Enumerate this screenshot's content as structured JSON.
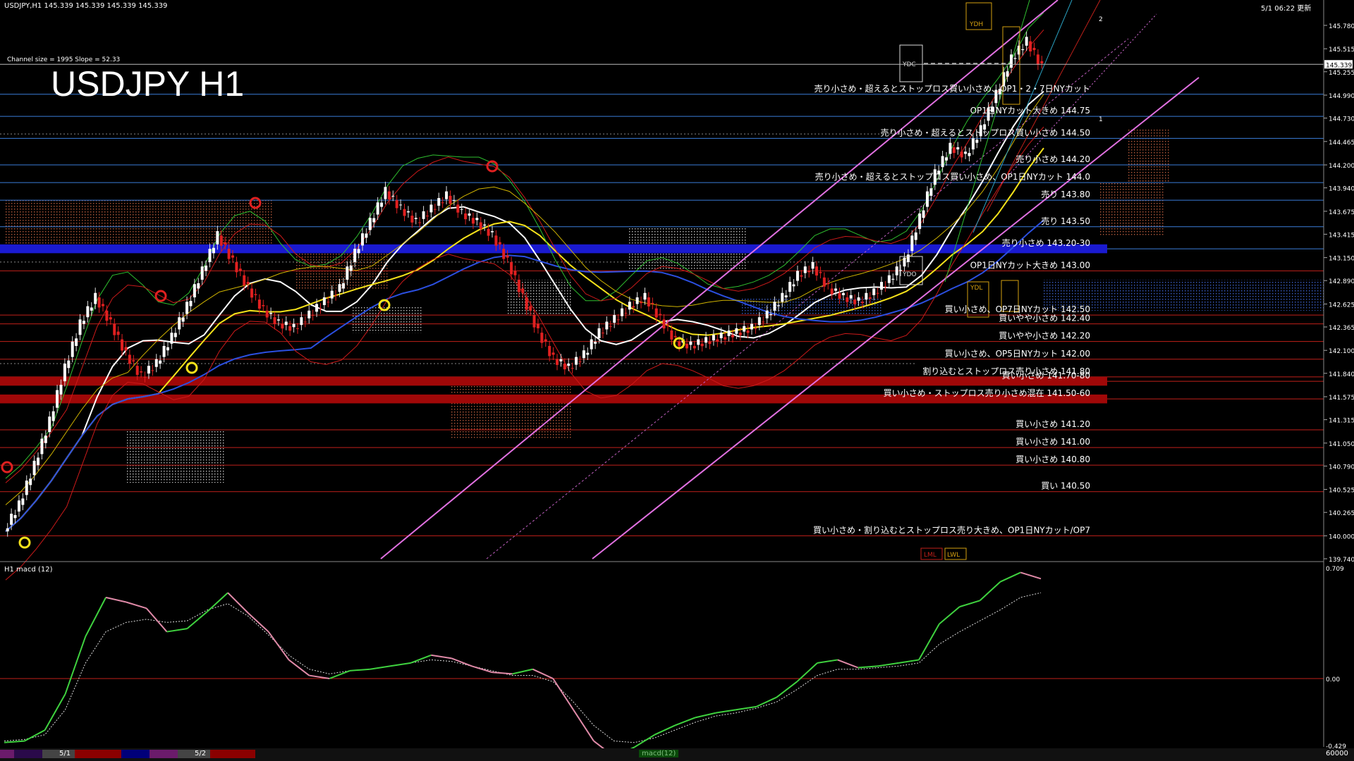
{
  "header": {
    "symbol_info": "USDJPY,H1  145.339 145.339 145.339 145.339",
    "timestamp": "5/1 06:22 更新",
    "channel_info": "Channel size = 1995 Slope = 52.33",
    "big_title": "USDJPY H1"
  },
  "chart_data": [
    {
      "type": "line",
      "title": "USDJPY H1",
      "ylim": [
        139.74,
        145.78
      ],
      "y_ticks": [
        "145.780",
        "145.515",
        "145.255",
        "144.990",
        "144.730",
        "144.465",
        "144.200",
        "143.940",
        "143.675",
        "143.415",
        "143.150",
        "142.890",
        "142.625",
        "142.365",
        "142.100",
        "141.840",
        "141.575",
        "141.315",
        "141.050",
        "140.790",
        "140.525",
        "140.265",
        "140.000",
        "139.740"
      ],
      "current_price": "145.339",
      "grid": false,
      "x_labels": [
        "5/1",
        "5/2"
      ],
      "price_path": [
        140.05,
        140.35,
        140.8,
        141.3,
        141.9,
        142.4,
        142.7,
        142.4,
        142.05,
        141.8,
        141.95,
        142.25,
        142.6,
        143.0,
        143.4,
        143.1,
        142.8,
        142.55,
        142.4,
        142.35,
        142.5,
        142.65,
        142.8,
        143.2,
        143.55,
        143.9,
        143.7,
        143.55,
        143.7,
        143.85,
        143.65,
        143.55,
        143.4,
        143.1,
        142.7,
        142.3,
        142.0,
        141.9,
        142.05,
        142.3,
        142.45,
        142.6,
        142.7,
        142.45,
        142.2,
        142.15,
        142.2,
        142.25,
        142.3,
        142.35,
        142.5,
        142.7,
        142.95,
        143.05,
        142.8,
        142.7,
        142.65,
        142.75,
        142.9,
        143.1,
        143.6,
        144.1,
        144.4,
        144.3,
        144.6,
        145.0,
        145.4,
        145.6,
        145.3
      ],
      "annotations": [
        {
          "text": "売り小さめ・超えるとストップロス買い小さめ、OP1・2・7日NYカット",
          "price": 145.0
        },
        {
          "text": "OP1日NYカット大きめ 144.75",
          "price": 144.75
        },
        {
          "text": "売り小さめ・超えるとストップロス買い小さめ 144.50",
          "price": 144.5
        },
        {
          "text": "売り小さめ 144.20",
          "price": 144.2
        },
        {
          "text": "売り小さめ・超えるとストップロス買い小さめ、OP1日NYカット 144.0",
          "price": 144.0
        },
        {
          "text": "売り 143.80",
          "price": 143.8
        },
        {
          "text": "売り 143.50",
          "price": 143.5
        },
        {
          "text": "売り小さめ 143.20-30",
          "price": 143.25
        },
        {
          "text": "OP1日NYカット大きめ 143.00",
          "price": 143.0
        },
        {
          "text": "買い小さめ、OP7日NYカット 142.50",
          "price": 142.5
        },
        {
          "text": "買いやや小さめ 142.40",
          "price": 142.4
        },
        {
          "text": "買いやや小さめ 142.20",
          "price": 142.2
        },
        {
          "text": "買い小さめ、OP5日NYカット 142.00",
          "price": 142.0
        },
        {
          "text": "割り込むとストップロス売り小さめ 141.80",
          "price": 141.8
        },
        {
          "text": "買い小さめ 141.70-80",
          "price": 141.75
        },
        {
          "text": "買い小さめ・ストップロス売り小さめ混在 141.50-60",
          "price": 141.55
        },
        {
          "text": "買い小さめ 141.20",
          "price": 141.2
        },
        {
          "text": "買い小さめ 141.00",
          "price": 141.0
        },
        {
          "text": "買い小さめ 140.80",
          "price": 140.8
        },
        {
          "text": "買い 140.50",
          "price": 140.5
        },
        {
          "text": "買い小さめ・割り込むとストップロス売り大きめ、OP1日NYカット/OP7",
          "price": 140.0
        }
      ],
      "markers": [
        "YDH",
        "YDC",
        "YDO",
        "YDL",
        "LML",
        "LWL",
        "1",
        "2"
      ]
    },
    {
      "type": "line",
      "title": "H1  macd (12)",
      "ylim": [
        -0.429,
        0.709
      ],
      "y_ticks": [
        "0.709",
        "0.00",
        "-0.429"
      ],
      "series": [
        {
          "values": [
            -0.41,
            -0.4,
            -0.33,
            -0.1,
            0.27,
            0.52,
            0.49,
            0.45,
            0.3,
            0.32,
            0.43,
            0.55,
            0.42,
            0.3,
            0.12,
            0.02,
            0.0,
            0.05,
            0.06,
            0.08,
            0.1,
            0.15,
            0.13,
            0.08,
            0.04,
            0.03,
            0.06,
            0.0,
            -0.2,
            -0.4,
            -0.5,
            -0.44,
            -0.36,
            -0.3,
            -0.25,
            -0.22,
            -0.2,
            -0.18,
            -0.12,
            -0.02,
            0.1,
            0.12,
            0.07,
            0.08,
            0.1,
            0.12,
            0.35,
            0.46,
            0.5,
            0.62,
            0.68,
            0.64
          ]
        },
        {
          "values": [
            -0.4,
            -0.39,
            -0.36,
            -0.2,
            0.1,
            0.3,
            0.36,
            0.38,
            0.36,
            0.37,
            0.44,
            0.48,
            0.4,
            0.28,
            0.15,
            0.06,
            0.03,
            0.05,
            0.06,
            0.08,
            0.1,
            0.12,
            0.11,
            0.08,
            0.05,
            0.02,
            0.02,
            -0.02,
            -0.15,
            -0.3,
            -0.4,
            -0.41,
            -0.38,
            -0.33,
            -0.28,
            -0.24,
            -0.22,
            -0.19,
            -0.15,
            -0.07,
            0.02,
            0.06,
            0.06,
            0.07,
            0.08,
            0.1,
            0.22,
            0.3,
            0.37,
            0.44,
            0.52,
            0.55
          ]
        }
      ]
    }
  ],
  "bottom_labels": [
    "5/1",
    "5/2"
  ],
  "scale_corner": "60000",
  "macd_tag": "macd(12)"
}
